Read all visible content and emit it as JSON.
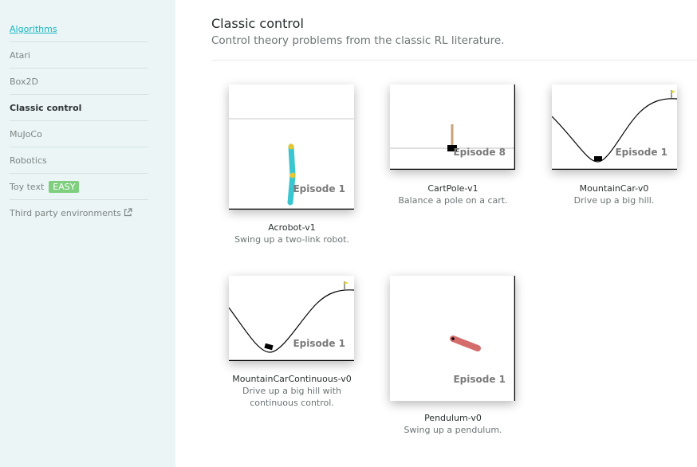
{
  "sidebar": {
    "items": [
      {
        "label": "Algorithms"
      },
      {
        "label": "Atari"
      },
      {
        "label": "Box2D"
      },
      {
        "label": "Classic control"
      },
      {
        "label": "MuJoCo"
      },
      {
        "label": "Robotics"
      },
      {
        "label": "Toy text",
        "badge": "EASY"
      },
      {
        "label": "Third party environments",
        "icon": "external-link-icon"
      }
    ]
  },
  "header": {
    "title": "Classic control",
    "subtitle": "Control theory problems from the classic RL literature."
  },
  "cards": [
    {
      "name": "Acrobot-v1",
      "description": "Swing up a two-link robot.",
      "episode": "Episode 1"
    },
    {
      "name": "CartPole-v1",
      "description": "Balance a pole on a cart.",
      "episode": "Episode 8"
    },
    {
      "name": "MountainCar-v0",
      "description": "Drive up a big hill.",
      "episode": "Episode 1"
    },
    {
      "name": "MountainCarContinuous-v0",
      "description": "Drive up a big hill with continuous control.",
      "episode": "Episode 1"
    },
    {
      "name": "Pendulum-v0",
      "description": "Swing up a pendulum.",
      "episode": "Episode 1"
    }
  ],
  "colors": {
    "sidebar_bg": "#ebf5f5",
    "link": "#17b6c4",
    "badge": "#7fcf7f",
    "acrobot": "#39c6d0",
    "joint": "#e6c630",
    "pendulum": "#d56c6c",
    "pole": "#caa27a",
    "flag": "#e6d430"
  }
}
